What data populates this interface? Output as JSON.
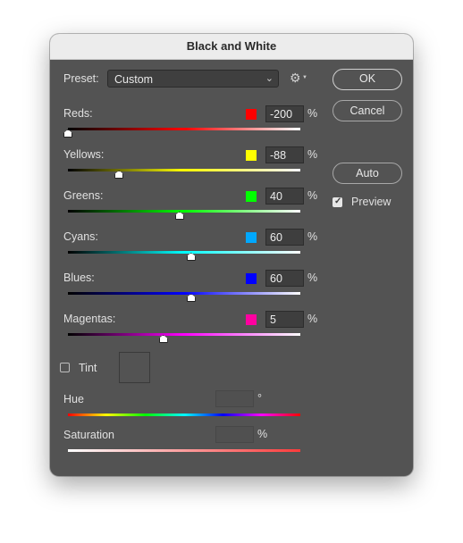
{
  "window": {
    "title": "Black and White"
  },
  "preset": {
    "label": "Preset:",
    "value": "Custom"
  },
  "buttons": {
    "ok": "OK",
    "cancel": "Cancel",
    "auto": "Auto"
  },
  "preview": {
    "label": "Preview",
    "checked": true
  },
  "channels": [
    {
      "label": "Reds:",
      "value": "-200",
      "unit": "%",
      "color": "#ff0000",
      "level": 0.0,
      "gradient": [
        "#000000",
        "#ff0000",
        "#ffffff"
      ]
    },
    {
      "label": "Yellows:",
      "value": "-88",
      "unit": "%",
      "color": "#ffff00",
      "level": 0.22,
      "gradient": [
        "#000000",
        "#ffff00",
        "#ffffff"
      ]
    },
    {
      "label": "Greens:",
      "value": "40",
      "unit": "%",
      "color": "#00ff00",
      "level": 0.48,
      "gradient": [
        "#000000",
        "#00ff00",
        "#ffffff"
      ]
    },
    {
      "label": "Cyans:",
      "value": "60",
      "unit": "%",
      "color": "#00a8ff",
      "level": 0.53,
      "gradient": [
        "#000000",
        "#00ffff",
        "#ffffff"
      ]
    },
    {
      "label": "Blues:",
      "value": "60",
      "unit": "%",
      "color": "#0000ff",
      "level": 0.53,
      "gradient": [
        "#000000",
        "#0000ff",
        "#ffffff"
      ]
    },
    {
      "label": "Magentas:",
      "value": "5",
      "unit": "%",
      "color": "#ff00a0",
      "level": 0.41,
      "gradient": [
        "#000000",
        "#ff00ff",
        "#ffffff"
      ]
    }
  ],
  "tint": {
    "label": "Tint",
    "checked": false
  },
  "hue": {
    "label": "Hue",
    "value": "",
    "unit": "°"
  },
  "saturation": {
    "label": "Saturation",
    "value": "",
    "unit": "%"
  },
  "colors": {
    "dialog_bg": "#535353",
    "titlebar_bg": "#ececec"
  }
}
